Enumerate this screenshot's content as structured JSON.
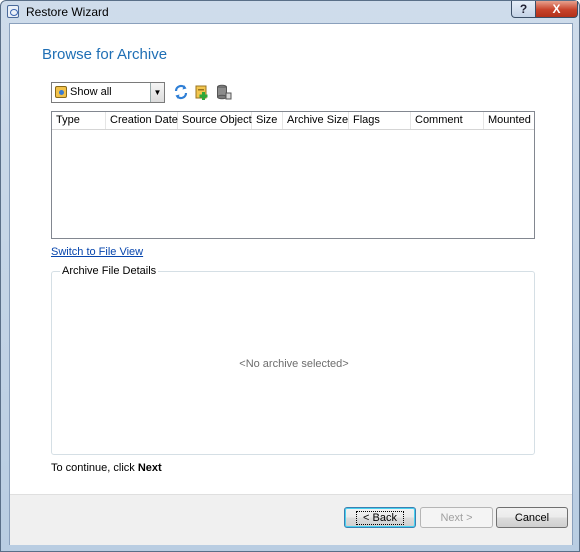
{
  "window": {
    "title": "Restore Wizard"
  },
  "titlebar_buttons": {
    "help": "?",
    "close": "X"
  },
  "page": {
    "heading": "Browse for Archive"
  },
  "filter": {
    "selected": "Show all"
  },
  "toolbar": {
    "icons": [
      "refresh-icon",
      "add-archive-icon",
      "archive-properties-icon"
    ]
  },
  "grid": {
    "columns": [
      "Type",
      "Creation Date",
      "Source Object",
      "Size",
      "Archive Size",
      "Flags",
      "Comment",
      "Mounted"
    ],
    "rows": []
  },
  "links": {
    "switch_view": "Switch to File View"
  },
  "details": {
    "group_label": "Archive File Details",
    "empty_text": "<No archive selected>"
  },
  "instruction": {
    "prefix": "To continue, click",
    "emphasis": "Next"
  },
  "buttons": {
    "back": "< Back",
    "next": "Next >",
    "cancel": "Cancel"
  }
}
